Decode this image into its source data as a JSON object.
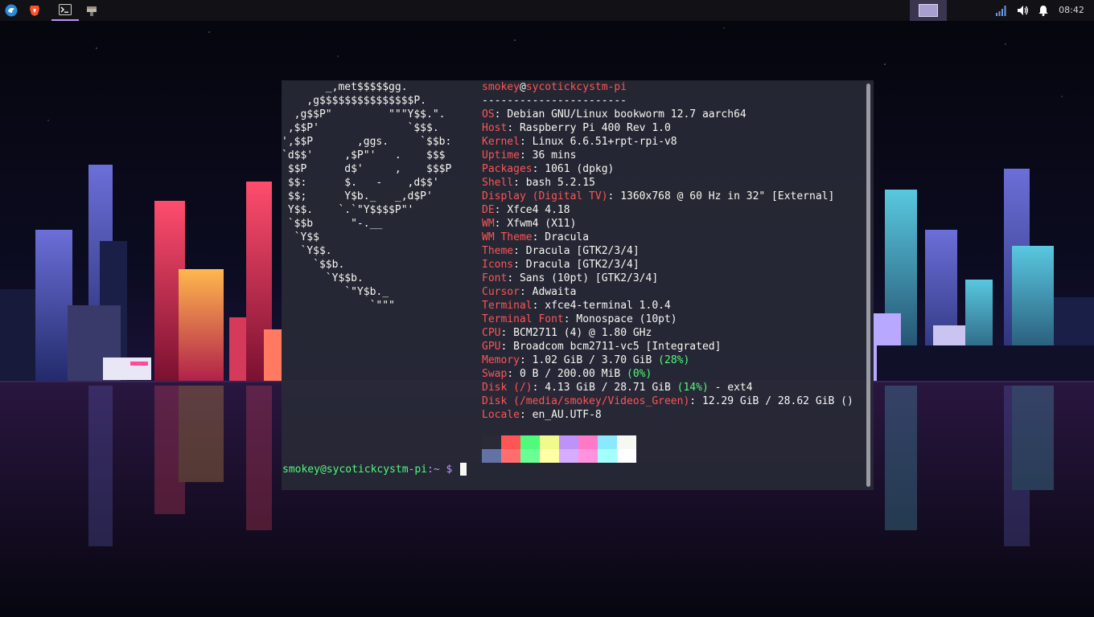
{
  "panel": {
    "launchers": [
      {
        "name": "app-menu-icon"
      },
      {
        "name": "brave-browser-icon"
      },
      {
        "name": "terminal-icon"
      },
      {
        "name": "file-manager-icon"
      }
    ],
    "clock": "08:42",
    "accent": "#bd93f9"
  },
  "terminal": {
    "logo_lines": [
      "       _,met$$$$$gg.",
      "    ,g$$$$$$$$$$$$$$$P.",
      "  ,g$$P\"         \"\"\"Y$$.\".",
      " ,$$P'              `$$$.",
      "',$$P       ,ggs.     `$$b:",
      "`d$$'     ,$P\"'   .    $$$",
      " $$P      d$'     ,    $$$P",
      " $$:      $.   -    ,d$$'",
      " $$;      Y$b._   _,d$P'",
      " Y$$.    `.`\"Y$$$$P\"'",
      " `$$b      \"-.__",
      "  `Y$$",
      "   `Y$$.",
      "     `$$b.",
      "       `Y$$b.",
      "          `\"Y$b._",
      "              `\"\"\""
    ],
    "user": "smokey",
    "at": "@",
    "host": "sycotickcystm-pi",
    "separator": "-----------------------",
    "info": [
      {
        "key": "OS",
        "value": "Debian GNU/Linux bookworm 12.7 aarch64"
      },
      {
        "key": "Host",
        "value": "Raspberry Pi 400 Rev 1.0"
      },
      {
        "key": "Kernel",
        "value": "Linux 6.6.51+rpt-rpi-v8"
      },
      {
        "key": "Uptime",
        "value": "36 mins"
      },
      {
        "key": "Packages",
        "value": "1061 (dpkg)"
      },
      {
        "key": "Shell",
        "value": "bash 5.2.15"
      },
      {
        "key": "Display (Digital TV)",
        "value": "1360x768 @ 60 Hz in 32\" [External]"
      },
      {
        "key": "DE",
        "value": "Xfce4 4.18"
      },
      {
        "key": "WM",
        "value": "Xfwm4 (X11)"
      },
      {
        "key": "WM Theme",
        "value": "Dracula"
      },
      {
        "key": "Theme",
        "value": "Dracula [GTK2/3/4]"
      },
      {
        "key": "Icons",
        "value": "Dracula [GTK2/3/4]"
      },
      {
        "key": "Font",
        "value": "Sans (10pt) [GTK2/3/4]"
      },
      {
        "key": "Cursor",
        "value": "Adwaita"
      },
      {
        "key": "Terminal",
        "value": "xfce4-terminal 1.0.4"
      },
      {
        "key": "Terminal Font",
        "value": "Monospace (10pt)"
      },
      {
        "key": "CPU",
        "value": "BCM2711 (4) @ 1.80 GHz"
      },
      {
        "key": "GPU",
        "value": "Broadcom bcm2711-vc5 [Integrated]"
      }
    ],
    "memory": {
      "key": "Memory",
      "value": "1.02 GiB / 3.70 GiB ",
      "pct": "(28%)"
    },
    "swap": {
      "key": "Swap",
      "value": "0 B / 200.00 MiB ",
      "pct": "(0%)"
    },
    "disk": {
      "key": "Disk (/)",
      "value": "4.13 GiB / 28.71 GiB ",
      "pct": "(14%)",
      "suffix": " - ext4"
    },
    "disk2": {
      "key": "Disk (/media/smokey/Videos_Green)",
      "value": "12.29 GiB / 28.62 GiB ()"
    },
    "locale": {
      "key": "Locale",
      "value": "en_AU.UTF-8"
    },
    "palette_top": [
      "#282a36",
      "#ff5555",
      "#50fa7b",
      "#f1fa8c",
      "#bd93f9",
      "#ff79c6",
      "#8be9fd",
      "#f8f8f2"
    ],
    "palette_bottom": [
      "#6272a4",
      "#ff6e6e",
      "#69ff94",
      "#ffffa5",
      "#d6acff",
      "#ff92df",
      "#a4ffff",
      "#ffffff"
    ],
    "prompt_user": "smokey@sycotickcystm-pi",
    "prompt_path": ":~",
    "prompt_symbol": " $"
  }
}
